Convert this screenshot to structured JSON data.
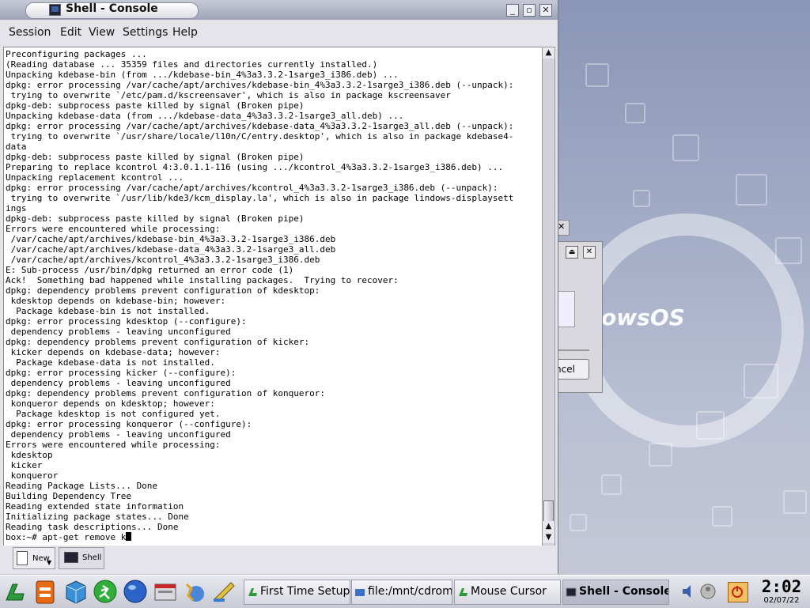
{
  "window": {
    "title": "Shell - Console",
    "buttons": {
      "minimize": "_",
      "maximize": "▫",
      "close": "✕"
    }
  },
  "menu": [
    "Session",
    "Edit",
    "View",
    "Settings",
    "Help"
  ],
  "terminal": {
    "lines": [
      "Preconfiguring packages ...",
      "(Reading database ... 35359 files and directories currently installed.)",
      "Unpacking kdebase-bin (from .../kdebase-bin_4%3a3.3.2-1sarge3_i386.deb) ...",
      "dpkg: error processing /var/cache/apt/archives/kdebase-bin_4%3a3.3.2-1sarge3_i386.deb (--unpack):",
      " trying to overwrite `/etc/pam.d/kscreensaver', which is also in package kscreensaver",
      "dpkg-deb: subprocess paste killed by signal (Broken pipe)",
      "Unpacking kdebase-data (from .../kdebase-data_4%3a3.3.2-1sarge3_all.deb) ...",
      "dpkg: error processing /var/cache/apt/archives/kdebase-data_4%3a3.3.2-1sarge3_all.deb (--unpack):",
      " trying to overwrite `/usr/share/locale/l10n/C/entry.desktop', which is also in package kdebase4-",
      "data",
      "dpkg-deb: subprocess paste killed by signal (Broken pipe)",
      "Preparing to replace kcontrol 4:3.0.1.1-116 (using .../kcontrol_4%3a3.3.2-1sarge3_i386.deb) ...",
      "Unpacking replacement kcontrol ...",
      "dpkg: error processing /var/cache/apt/archives/kcontrol_4%3a3.3.2-1sarge3_i386.deb (--unpack):",
      " trying to overwrite `/usr/lib/kde3/kcm_display.la', which is also in package lindows-displaysett",
      "ings",
      "dpkg-deb: subprocess paste killed by signal (Broken pipe)",
      "Errors were encountered while processing:",
      " /var/cache/apt/archives/kdebase-bin_4%3a3.3.2-1sarge3_i386.deb",
      " /var/cache/apt/archives/kdebase-data_4%3a3.3.2-1sarge3_all.deb",
      " /var/cache/apt/archives/kcontrol_4%3a3.3.2-1sarge3_i386.deb",
      "E: Sub-process /usr/bin/dpkg returned an error code (1)",
      "Ack!  Something bad happened while installing packages.  Trying to recover:",
      "dpkg: dependency problems prevent configuration of kdesktop:",
      " kdesktop depends on kdebase-bin; however:",
      "  Package kdebase-bin is not installed.",
      "dpkg: error processing kdesktop (--configure):",
      " dependency problems - leaving unconfigured",
      "dpkg: dependency problems prevent configuration of kicker:",
      " kicker depends on kdebase-data; however:",
      "  Package kdebase-data is not installed.",
      "dpkg: error processing kicker (--configure):",
      " dependency problems - leaving unconfigured",
      "dpkg: dependency problems prevent configuration of konqueror:",
      " konqueror depends on kdesktop; however:",
      "  Package kdesktop is not configured yet.",
      "dpkg: error processing konqueror (--configure):",
      " dependency problems - leaving unconfigured",
      "Errors were encountered while processing:",
      " kdesktop",
      " kicker",
      " konqueror",
      "Reading Package Lists... Done",
      "Building Dependency Tree",
      "Reading extended state information",
      "Initializing package states... Done",
      "Reading task descriptions... Done"
    ],
    "prompt": "box:~# apt-get remove k"
  },
  "console_tabs": [
    {
      "label": "New",
      "icon": "new-session-icon"
    },
    {
      "label": "Shell",
      "icon": "terminal-icon"
    }
  ],
  "background": {
    "logo_text": "dowsOS",
    "dialog_button": "ncel"
  },
  "taskbar": {
    "quicklaunch": [
      "start-menu-icon",
      "click-n-run-icon",
      "my-computer-icon",
      "running-man-icon",
      "web-browser-icon",
      "file-manager-icon",
      "run-icon",
      "paint-icon"
    ],
    "tasks": [
      {
        "label": "First Time Setup",
        "icon": "setup-icon"
      },
      {
        "label": "file:/mnt/cdrom1",
        "icon": "folder-icon"
      },
      {
        "label": "Mouse Cursor",
        "icon": "mouse-icon"
      },
      {
        "label": "Shell - Console",
        "icon": "terminal-icon"
      }
    ],
    "tray": [
      "volume-icon",
      "user-icon",
      "power-icon"
    ],
    "clock": {
      "time": "2:02",
      "date": "02/07/22"
    }
  }
}
